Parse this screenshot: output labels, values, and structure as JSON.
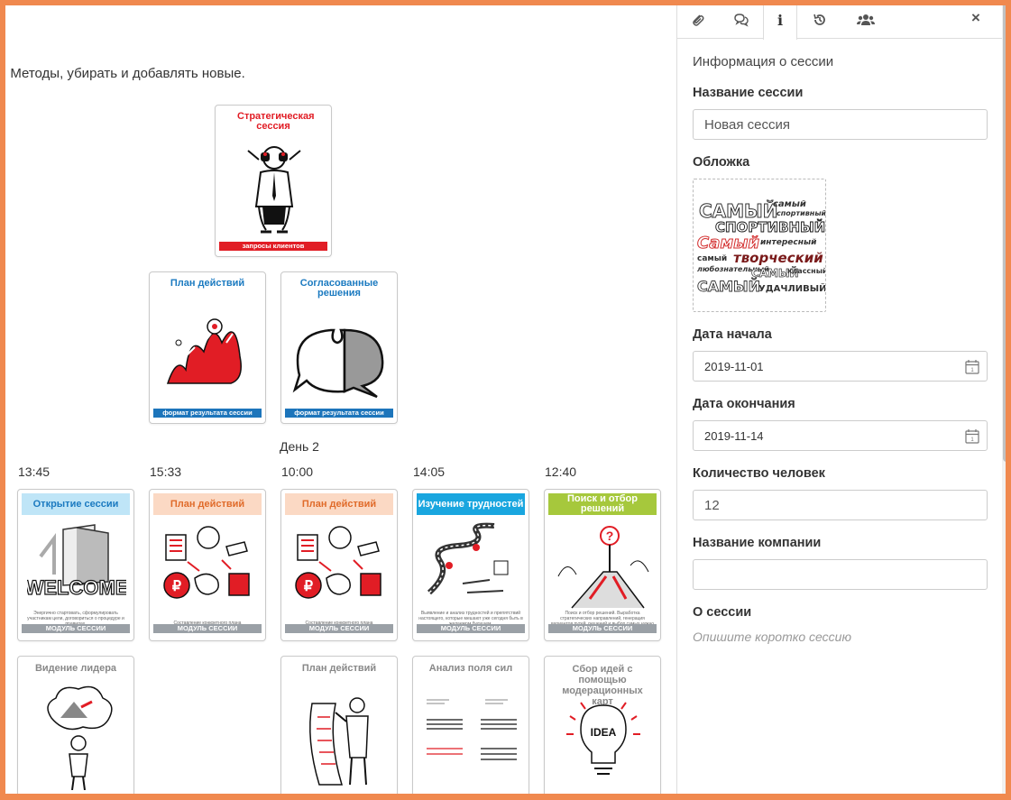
{
  "canvas": {
    "intro_text": ", Методы, убирать и добавлять новые.",
    "day_label": "День 2",
    "top_card": {
      "title": "Стратегическая сессия",
      "footer": "запросы клиентов"
    },
    "result_cards": [
      {
        "title": "План действий",
        "footer": "формат результата сессии"
      },
      {
        "title": "Согласованные решения",
        "footer": "формат результата сессии"
      }
    ],
    "timeline": [
      {
        "time": "13:45",
        "title": "Открытие сессии",
        "footer": "МОДУЛЬ СЕССИИ",
        "desc": "Энергично стартовать, сформулировать участникам цели, договориться о процедуре и правилах."
      },
      {
        "time": "15:33",
        "title": "План действий",
        "footer": "МОДУЛЬ СЕССИИ",
        "desc": "Составление конкретного плана"
      },
      {
        "time": "10:00",
        "title": "План действий",
        "footer": "МОДУЛЬ СЕССИИ",
        "desc": "Составление конкретного плана"
      },
      {
        "time": "14:05",
        "title": "Изучение трудностей",
        "footer": "МОДУЛЬ СЕССИИ",
        "desc": "Выявление и анализ трудностей и препятствий настоящего, которые мешают уже сегодня быть в желаемом будущем."
      },
      {
        "time": "12:40",
        "title": "Поиск и отбор решений",
        "footer": "МОДУЛЬ СЕССИИ",
        "desc": "Поиск и отбор решений. Выработка стратегических направлений, генерация вариантов путей, решений и выбор самых нужно действовать."
      }
    ],
    "bottom_cards": [
      {
        "title": "Видение лидера"
      },
      {
        "title": "План действий"
      },
      {
        "title": "Анализ поля сил"
      },
      {
        "title": "Сбор идей с помощью модерационных карт"
      }
    ]
  },
  "panel": {
    "tabs": [
      {
        "icon": "paperclip-icon"
      },
      {
        "icon": "comments-icon"
      },
      {
        "icon": "info-icon"
      },
      {
        "icon": "history-icon"
      },
      {
        "icon": "users-icon"
      }
    ],
    "close_icon": "×",
    "section_title": "Информация о сессии",
    "session_name_label": "Название сессии",
    "session_name_value": "Новая сессия",
    "cover_label": "Обложка",
    "cover_words": [
      "Самый",
      "Самый",
      "спортивный",
      "Самый",
      "интересный",
      "Самый",
      "творческий",
      "любознательный",
      "классный",
      "Самый",
      "Самый",
      "удачливый"
    ],
    "start_label": "Дата начала",
    "start_value": "2019-11-01",
    "end_label": "Дата окончания",
    "end_value": "2019-11-14",
    "people_label": "Количество человек",
    "people_value": "12",
    "company_label": "Название компании",
    "company_value": "",
    "about_label": "О сессии",
    "about_placeholder": "Опишите коротко сессию"
  },
  "colors": {
    "frame": "#f0894f",
    "red": "#e11d25",
    "blue_title": "#1b7ac0",
    "footer_blue": "#1d75bb",
    "footer_gray": "#9aa0a6",
    "light_blue": "#bfe5f7",
    "light_orange": "#fbd9c4",
    "cyan": "#19a6df",
    "green": "#a6c83c"
  }
}
